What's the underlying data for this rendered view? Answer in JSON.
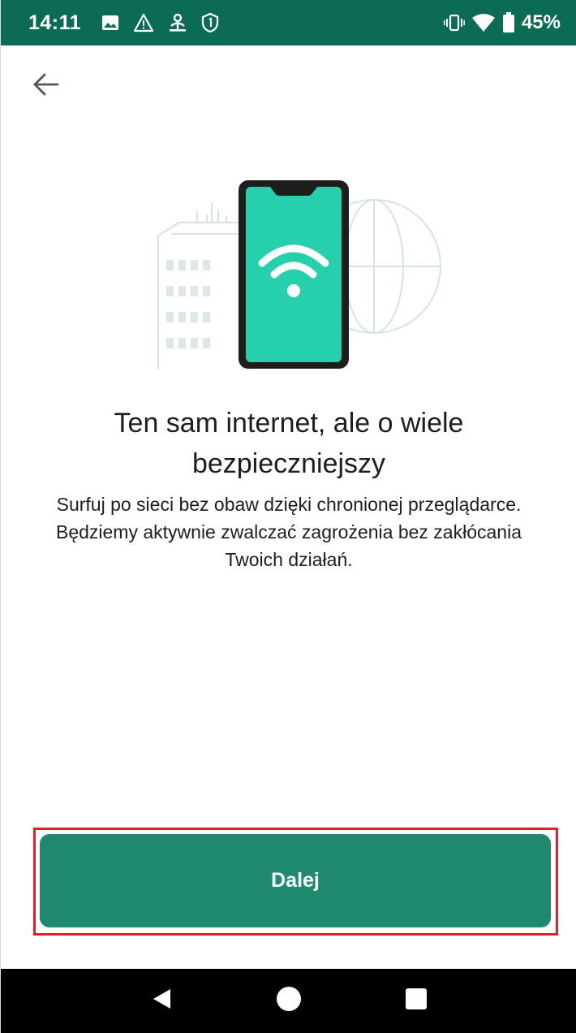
{
  "status_bar": {
    "time": "14:11",
    "battery_percent": "45%",
    "icons_left": [
      "image-icon",
      "warning-icon",
      "vpn-person-icon",
      "shield-1-icon"
    ],
    "icons_right": [
      "vibrate-icon",
      "wifi-icon",
      "battery-icon"
    ],
    "background_color": "#0c6b54"
  },
  "header": {
    "back_icon": "arrow-left-icon"
  },
  "illustration": {
    "icons": [
      "building-icon",
      "phone-icon",
      "wifi-icon",
      "globe-icon"
    ],
    "accent_color": "#26d0ac"
  },
  "content": {
    "title": "Ten sam internet, ale o wiele bezpieczniejszy",
    "description": "Surfuj po sieci bez obaw dzięki chronionej przeglądarce. Będziemy aktywnie zwalczać zagrożenia bez zakłócania Twoich działań."
  },
  "actions": {
    "next_label": "Dalej",
    "button_color": "#1f8a6f",
    "highlight_color": "#e41e2b"
  },
  "nav_bar": {
    "icons": [
      "back-triangle-icon",
      "home-circle-icon",
      "recents-square-icon"
    ]
  }
}
